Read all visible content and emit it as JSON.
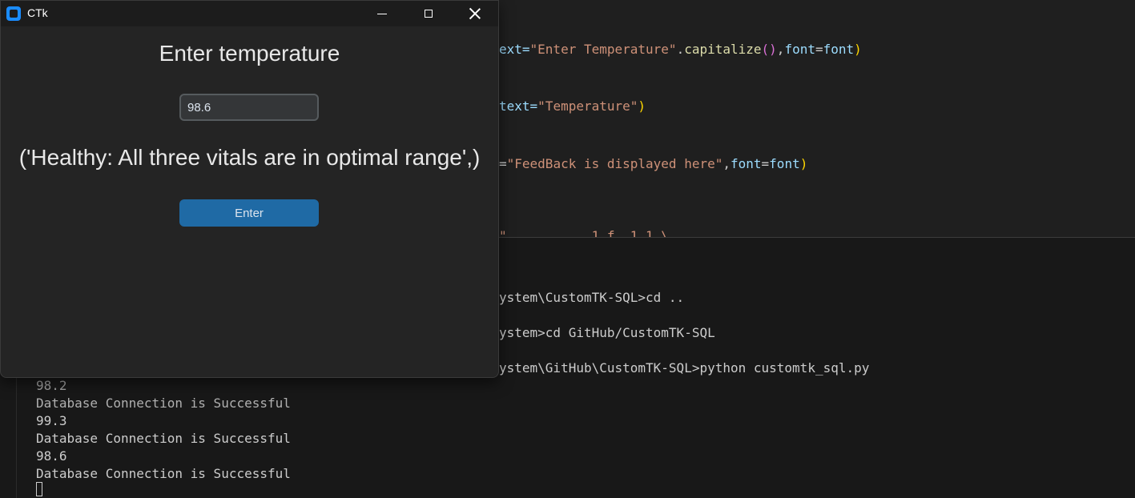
{
  "window": {
    "title": "CTk",
    "heading": "Enter temperature",
    "input_value": "98.6",
    "feedback": "('Healthy: All three vitals are in optimal range',)",
    "enter_label": "Enter"
  },
  "editor": {
    "lines": [
      {
        "a": "ext=",
        "b": "\"Enter Temperature\"",
        "c": ".",
        "d": "capitalize",
        "e": "()",
        "f": ",",
        "g": "font",
        "h": "=",
        "i": "font",
        "j": ")"
      },
      {
        "a": "text=",
        "b": "\"Temperature\"",
        "j": ")"
      },
      {
        "a": "=",
        "b": "\"FeedBack is displayed here\"",
        "c": ",",
        "g": "font",
        "h": "=",
        "i": "font",
        "j": ")"
      }
    ],
    "partial_line": "\"         _ 1 f  1_1 \\"
  },
  "terminal": {
    "lines": [
      "ystem\\CustomTK-SQL>cd ..",
      "ystem>cd GitHub/CustomTK-SQL",
      "ystem\\GitHub\\CustomTK-SQL>python customtk_sql.py",
      "98.2",
      "Database Connection is Successful",
      "99.3",
      "Database Connection is Successful",
      "98.6",
      "Database Connection is Successful"
    ]
  },
  "colors": {
    "accent": "#1f6aa5",
    "app_icon": "#1a8cff",
    "string": "#ce9178",
    "variable": "#9cdcfe",
    "function": "#dcdcaa"
  }
}
